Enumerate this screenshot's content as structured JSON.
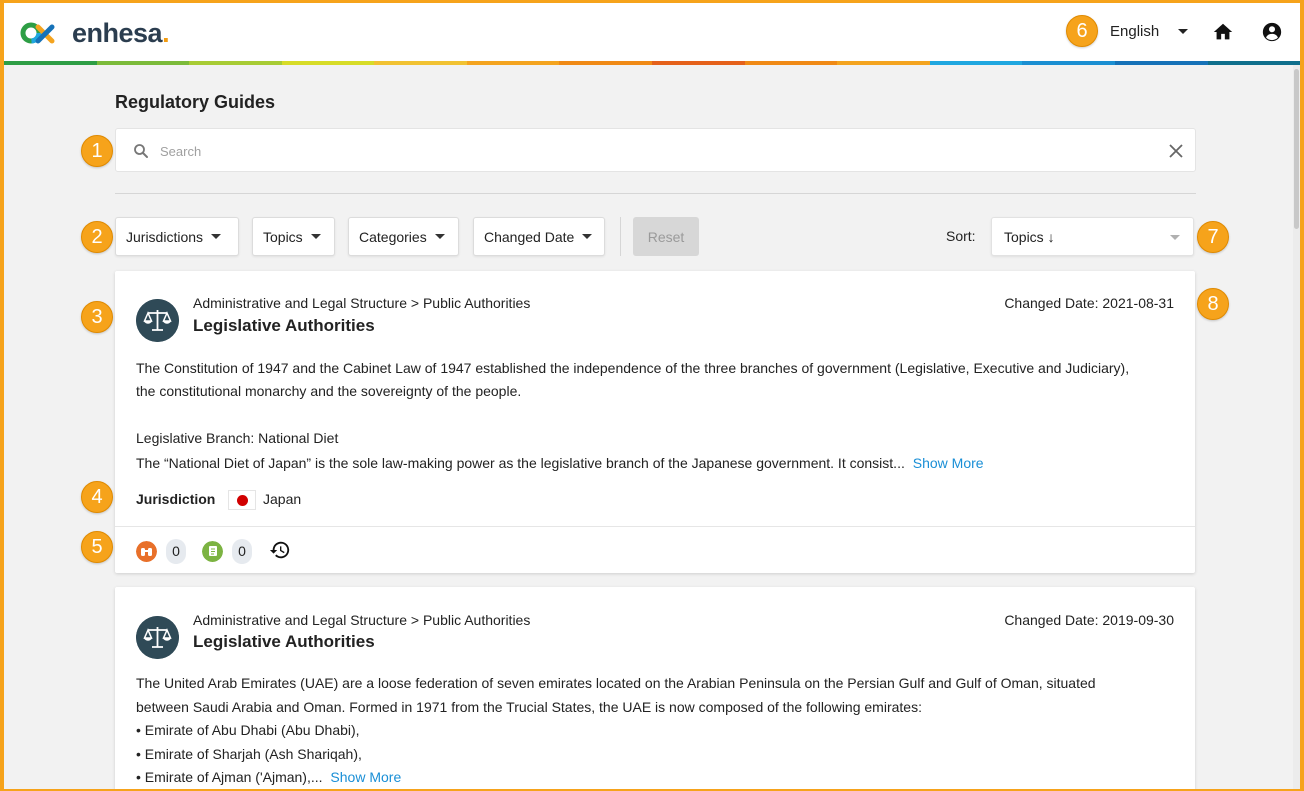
{
  "header": {
    "logo_text": "enhesa",
    "logo_dot": ".",
    "language": "English"
  },
  "stripe_colors": [
    "#2e9e45",
    "#7cbb3a",
    "#a8cc35",
    "#d7dc28",
    "#f1c232",
    "#f4a41f",
    "#f08a16",
    "#e5611b",
    "#f08a16",
    "#f4a41f",
    "#20a7e0",
    "#1b8fd2",
    "#1672b8",
    "#0f6f8c"
  ],
  "page": {
    "title": "Regulatory Guides",
    "search_placeholder": "Search"
  },
  "filters": {
    "jurisdictions": "Jurisdictions",
    "topics": "Topics",
    "categories": "Categories",
    "changed_date": "Changed Date",
    "reset": "Reset",
    "sort_label": "Sort:",
    "sort_value": "Topics ↓"
  },
  "cards": [
    {
      "breadcrumb": "Administrative and Legal Structure > Public Authorities",
      "title": "Legislative Authorities",
      "changed": "Changed Date: 2021-08-31",
      "desc_line1": "The Constitution of 1947 and the Cabinet Law of 1947 established the independence of the three branches of government (Legislative, Executive and Judiciary),",
      "desc_line2": "the constitutional monarchy and the sovereignty of the people.",
      "sub_head": "Legislative Branch: National Diet",
      "sub_text": "The “National Diet of Japan” is the sole law-making power as the legislative branch of the Japanese government. It consist...",
      "show_more": "Show More",
      "jurisdiction_label": "Jurisdiction",
      "jurisdiction_value": "Japan",
      "count_a": "0",
      "count_b": "0"
    },
    {
      "breadcrumb": "Administrative and Legal Structure > Public Authorities",
      "title": "Legislative Authorities",
      "changed": "Changed Date: 2019-09-30",
      "desc_line1": "The United Arab Emirates (UAE) are a loose federation of seven emirates located on the Arabian Peninsula on the Persian Gulf and Gulf of Oman, situated",
      "desc_line2": "between Saudi Arabia and Oman. Formed in 1971 from the Trucial States, the UAE is now composed of the following emirates:",
      "bullet1": "• Emirate of Abu Dhabi (Abu Dhabi),",
      "bullet2": "• Emirate of Sharjah (Ash Shariqah),",
      "bullet3": "• Emirate of Ajman ('Ajman),...",
      "show_more": "Show More"
    }
  ],
  "badges": [
    "1",
    "2",
    "3",
    "4",
    "5",
    "6",
    "7",
    "8"
  ]
}
